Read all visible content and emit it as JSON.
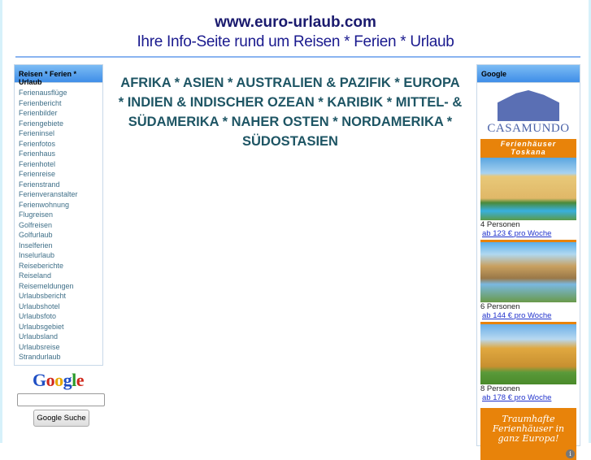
{
  "header": {
    "site": "www.euro-urlaub.com",
    "tagline": "Ihre Info-Seite rund um Reisen * Ferien * Urlaub"
  },
  "left": {
    "title": "Reisen * Ferien * Urlaub",
    "items": [
      "Ferienausflüge",
      "Ferienbericht",
      "Ferienbilder",
      "Feriengebiete",
      "Ferieninsel",
      "Ferienfotos",
      "Ferienhaus",
      "Ferienhotel",
      "Ferienreise",
      "Ferienstrand",
      "Ferienveranstalter",
      "Ferienwohnung",
      "Flugreisen",
      "Golfreisen",
      "Golfurlaub",
      "Inselferien",
      "Inselurlaub",
      "Reiseberichte",
      "Reiseland",
      "Reisemeldungen",
      "Urlaubsbericht",
      "Urlaubshotel",
      "Urlaubsfoto",
      "Urlaubsgebiet",
      "Urlaubsland",
      "Urlaubsreise",
      "Strandurlaub"
    ]
  },
  "search": {
    "logo": "Google",
    "button": "Google Suche",
    "value": ""
  },
  "main": {
    "regions": "AFRIKA * ASIEN * AUSTRALIEN & PAZIFIK * EUROPA * INDIEN & INDISCHER OZEAN * KARIBIK * MITTEL- & SÜDAMERIKA * NAHER OSTEN * NORDAMERIKA * SÜDOSTASIEN"
  },
  "right": {
    "title": "Google",
    "ad": {
      "brand": "CASAMUNDO",
      "banner1": "Ferienhäuser",
      "banner2": "Toskana",
      "offers": [
        {
          "persons": "4 Personen",
          "price": "ab 123 € pro Woche"
        },
        {
          "persons": "6 Personen",
          "price": "ab 144 € pro Woche"
        },
        {
          "persons": "8 Personen",
          "price": "ab 178 € pro Woche"
        }
      ],
      "promo1": "Traumhafte",
      "promo2": "Ferienhäuser in",
      "promo3": "ganz Europa!",
      "info": "i"
    }
  }
}
